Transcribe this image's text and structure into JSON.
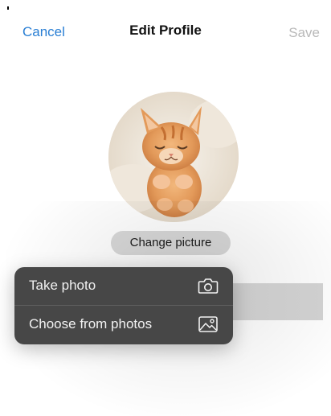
{
  "nav": {
    "cancel_label": "Cancel",
    "title": "Edit Profile",
    "save_label": "Save"
  },
  "profile": {
    "change_picture_label": "Change picture"
  },
  "photo_menu": {
    "items": [
      {
        "label": "Take photo",
        "icon": "camera-icon"
      },
      {
        "label": "Choose from photos",
        "icon": "photo-library-icon"
      }
    ]
  },
  "colors": {
    "accent": "#2a7fd4",
    "disabled": "#b9b9b9",
    "menu_background": "#474747",
    "pill_background": "#d9d9d9"
  }
}
